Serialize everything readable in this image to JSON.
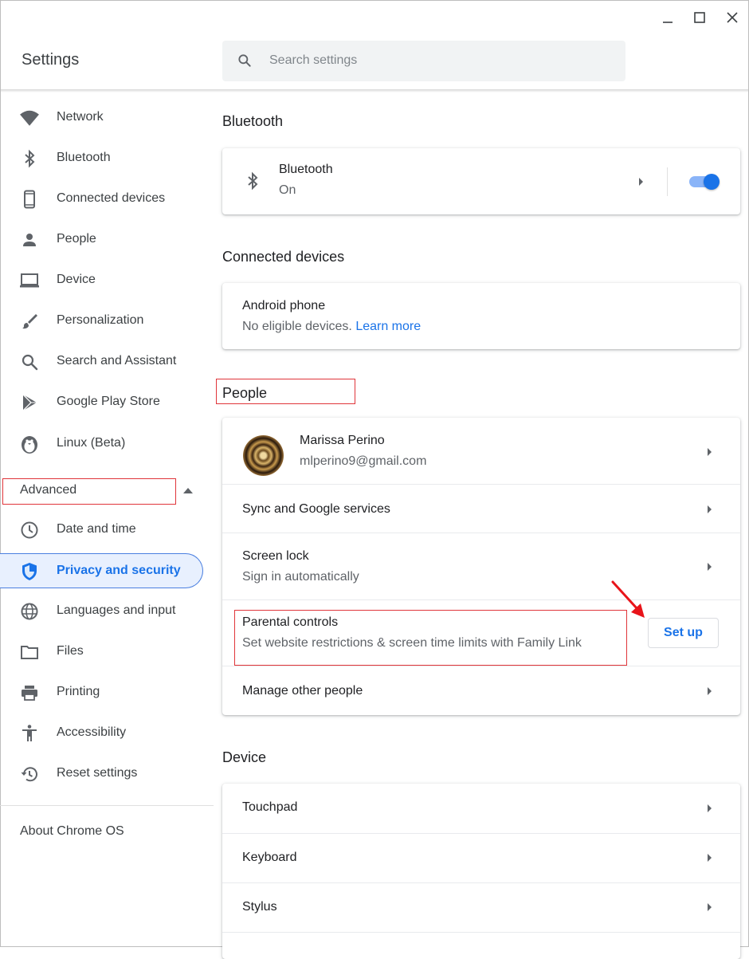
{
  "app": {
    "title": "Settings"
  },
  "window_controls": {
    "minimize_icon": "minimize-icon",
    "maximize_icon": "maximize-icon",
    "close_icon": "close-icon"
  },
  "search": {
    "placeholder": "Search settings",
    "icon": "search-icon"
  },
  "sidebar": {
    "items": [
      {
        "label": "Network",
        "icon": "wifi-icon"
      },
      {
        "label": "Bluetooth",
        "icon": "bluetooth-icon"
      },
      {
        "label": "Connected devices",
        "icon": "phone-icon"
      },
      {
        "label": "People",
        "icon": "person-icon"
      },
      {
        "label": "Device",
        "icon": "laptop-icon"
      },
      {
        "label": "Personalization",
        "icon": "brush-icon"
      },
      {
        "label": "Search and Assistant",
        "icon": "search-icon"
      },
      {
        "label": "Google Play Store",
        "icon": "play-store-icon"
      },
      {
        "label": "Linux (Beta)",
        "icon": "penguin-icon"
      }
    ],
    "advanced_label": "Advanced",
    "advanced_items": [
      {
        "label": "Date and time",
        "icon": "clock-icon"
      },
      {
        "label": "Privacy and security",
        "icon": "shield-icon",
        "active": true
      },
      {
        "label": "Languages and input",
        "icon": "globe-icon"
      },
      {
        "label": "Files",
        "icon": "folder-icon"
      },
      {
        "label": "Printing",
        "icon": "printer-icon"
      },
      {
        "label": "Accessibility",
        "icon": "accessibility-icon"
      },
      {
        "label": "Reset settings",
        "icon": "restore-icon"
      }
    ],
    "about_label": "About Chrome OS"
  },
  "bluetooth_section": {
    "title": "Bluetooth",
    "row": {
      "title": "Bluetooth",
      "status": "On",
      "toggle_on": true
    }
  },
  "connected_devices_section": {
    "title": "Connected devices",
    "row": {
      "title": "Android phone",
      "subtitle": "No eligible devices.",
      "link": "Learn more"
    }
  },
  "people_section": {
    "title": "People",
    "account": {
      "name": "Marissa Perino",
      "email": "mlperino9@gmail.com"
    },
    "sync_label": "Sync and Google services",
    "screen_lock": {
      "title": "Screen lock",
      "subtitle": "Sign in automatically"
    },
    "parental_controls": {
      "title": "Parental controls",
      "subtitle": "Set website restrictions & screen time limits with Family Link",
      "button": "Set up"
    },
    "manage_label": "Manage other people"
  },
  "device_section": {
    "title": "Device",
    "items": [
      "Touchpad",
      "Keyboard",
      "Stylus"
    ]
  },
  "colors": {
    "accent": "#1a73e8",
    "highlight_box": "#e0353a",
    "annotation_arrow": "#e8141a"
  }
}
